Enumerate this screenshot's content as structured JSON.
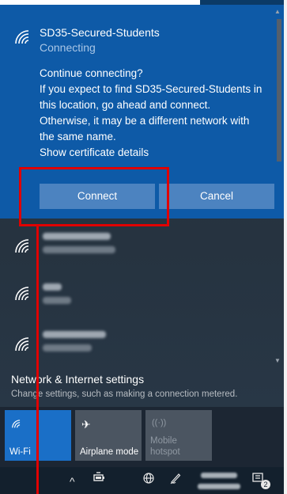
{
  "selected_network": {
    "ssid": "SD35-Secured-Students",
    "status": "Connecting",
    "prompt": {
      "heading": "Continue connecting?",
      "line1": "If you expect to find SD35-Secured-Students in",
      "line2": "this location, go ahead and connect.",
      "line3": "Otherwise, it may be a different network with",
      "line4": "the same name.",
      "certificate_link": "Show certificate details"
    },
    "connect_label": "Connect",
    "cancel_label": "Cancel"
  },
  "settings": {
    "title": "Network & Internet settings",
    "subtitle": "Change settings, such as making a connection metered."
  },
  "quick_actions": {
    "wifi": "Wi-Fi",
    "airplane": "Airplane mode",
    "hotspot_line1": "Mobile",
    "hotspot_line2": "hotspot"
  },
  "taskbar": {
    "chevron": "^",
    "notification_count": "2"
  },
  "icons": {
    "network": "wifi-icon",
    "airplane": "airplane-icon",
    "hotspot": "hotspot-icon",
    "globe": "globe-icon",
    "pen": "pen-icon",
    "battery": "battery-icon",
    "action_center": "action-center-icon"
  },
  "colors": {
    "accent": "#0e5aa7",
    "button": "#4c83c0",
    "highlight": "#e00000"
  }
}
